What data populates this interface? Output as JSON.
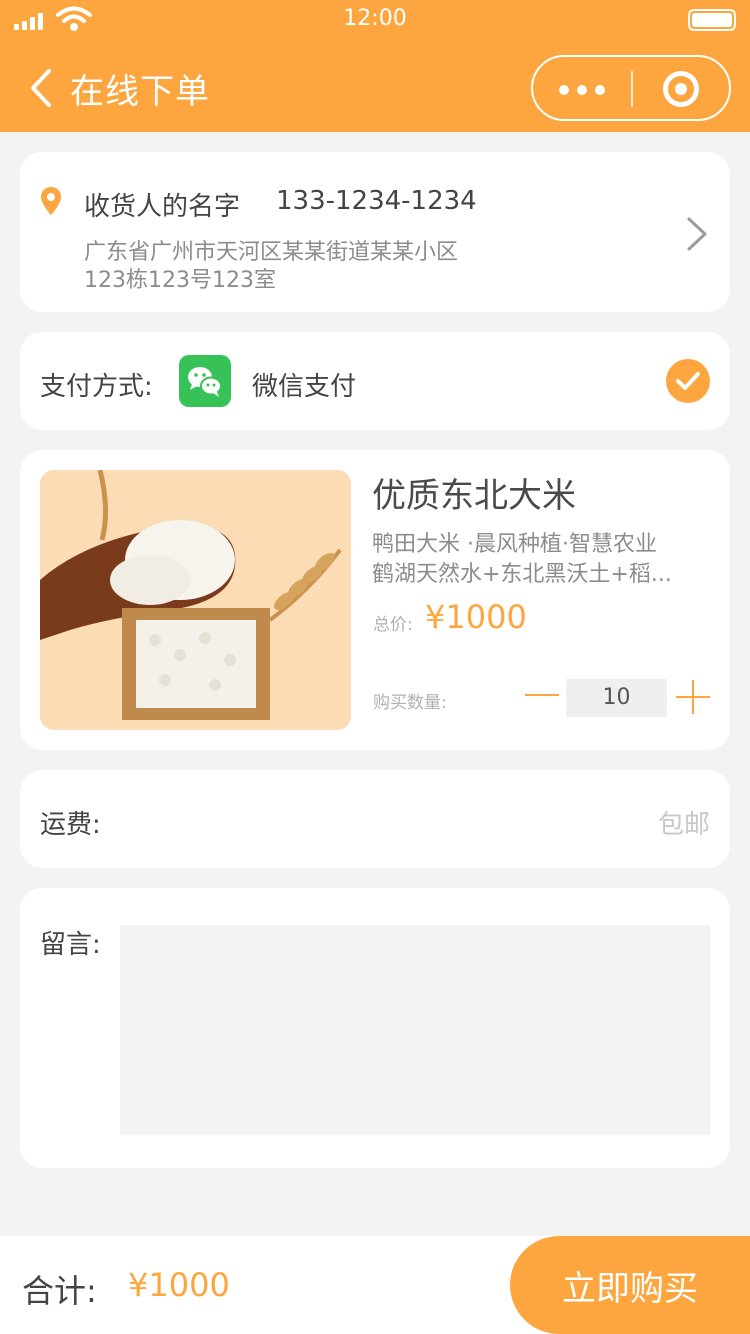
{
  "status_bar": {
    "time": "12:00"
  },
  "header": {
    "title": "在线下单"
  },
  "address": {
    "name": "收货人的名字",
    "phone": "133-1234-1234",
    "line1": "广东省广州市天河区某某街道某某小区",
    "line2": "123栋123号123室"
  },
  "payment": {
    "label": "支付方式:",
    "method": "微信支付"
  },
  "product": {
    "title": "优质东北大米",
    "desc1": "鸭田大米 ·晨风种植·智慧农业",
    "desc2": "鹤湖天然水+东北黑沃土+稻...",
    "price_label": "总价:",
    "price": "¥1000",
    "qty_label": "购买数量:",
    "quantity": "10"
  },
  "shipping": {
    "label": "运费:",
    "value": "包邮"
  },
  "note": {
    "label": "留言:"
  },
  "footer": {
    "total_label": "合计:",
    "total": "¥1000",
    "buy_label": "立即购买"
  },
  "colors": {
    "accent": "#fda63f",
    "wechat": "#36c256"
  },
  "icons": [
    "signal-icon",
    "wifi-icon",
    "battery-icon",
    "back-icon",
    "more-icon",
    "target-icon",
    "location-icon",
    "chevron-right-icon",
    "wechat-icon",
    "check-icon",
    "minus-icon",
    "plus-icon"
  ]
}
